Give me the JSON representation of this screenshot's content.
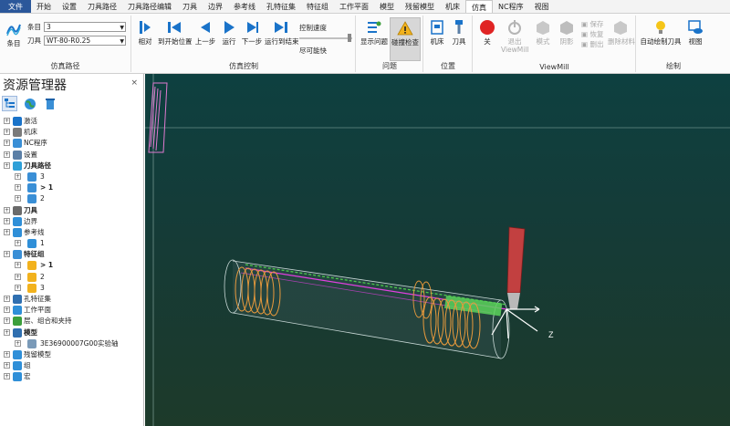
{
  "menubar": {
    "items": [
      "文件",
      "开始",
      "设置",
      "刀具路径",
      "刀具路径编辑",
      "刀具",
      "边界",
      "参考线",
      "孔特征集",
      "特征组",
      "工作平面",
      "模型",
      "残留模型",
      "机床",
      "仿真",
      "NC程序",
      "视图"
    ],
    "active": "仿真"
  },
  "ribbon": {
    "path_group": {
      "label": "仿真路径",
      "button": "条目",
      "field1_label": "条目",
      "field1_value": "3",
      "field2_label": "刀具",
      "field2_value": "WT-80-R0.25"
    },
    "sim_control": {
      "label": "仿真控制",
      "buttons": [
        "相对",
        "到开始位置",
        "上一步",
        "运行",
        "下一步",
        "运行到结束"
      ],
      "speed_label": "控制速度",
      "speed_value": "尽可能快"
    },
    "issues": {
      "label": "问题",
      "buttons": [
        "显示问题",
        "碰撞检查"
      ]
    },
    "position": {
      "label": "位置",
      "buttons": [
        "机床",
        "刀具"
      ]
    },
    "viewmill": {
      "label": "ViewMill",
      "buttons": [
        "关",
        "退出 ViewMill",
        "模式",
        "阴影",
        "保存",
        "恢复",
        "删出",
        "删除材料"
      ]
    },
    "draw": {
      "label": "绘制",
      "buttons": [
        "自动绘制刀具",
        "视图"
      ]
    }
  },
  "explorer": {
    "title": "资源管理器",
    "close": "×",
    "tree": [
      {
        "label": "激活",
        "level": 0,
        "bold": false
      },
      {
        "label": "机床",
        "level": 0,
        "bold": false
      },
      {
        "label": "NC程序",
        "level": 0,
        "bold": false
      },
      {
        "label": "设置",
        "level": 0,
        "bold": false
      },
      {
        "label": "刀具路径",
        "level": 0,
        "bold": true
      },
      {
        "label": "3",
        "level": 1,
        "bold": false
      },
      {
        "label": "> 1",
        "level": 1,
        "bold": true
      },
      {
        "label": "2",
        "level": 1,
        "bold": false
      },
      {
        "label": "刀具",
        "level": 0,
        "bold": true
      },
      {
        "label": "边界",
        "level": 0,
        "bold": false
      },
      {
        "label": "参考线",
        "level": 0,
        "bold": false
      },
      {
        "label": "1",
        "level": 1,
        "bold": false
      },
      {
        "label": "特征组",
        "level": 0,
        "bold": true
      },
      {
        "label": "> 1",
        "level": 1,
        "bold": true
      },
      {
        "label": "2",
        "level": 1,
        "bold": false
      },
      {
        "label": "3",
        "level": 1,
        "bold": false
      },
      {
        "label": "孔特征集",
        "level": 0,
        "bold": false
      },
      {
        "label": "工作平面",
        "level": 0,
        "bold": false
      },
      {
        "label": "层、组合和夹持",
        "level": 0,
        "bold": false
      },
      {
        "label": "模型",
        "level": 0,
        "bold": true
      },
      {
        "label": "3E36900007G00实验轴",
        "level": 1,
        "bold": false
      },
      {
        "label": "残留模型",
        "level": 0,
        "bold": false
      },
      {
        "label": "组",
        "level": 0,
        "bold": false
      },
      {
        "label": "宏",
        "level": 0,
        "bold": false
      }
    ]
  },
  "viewport": {
    "axis_label": "Z"
  }
}
